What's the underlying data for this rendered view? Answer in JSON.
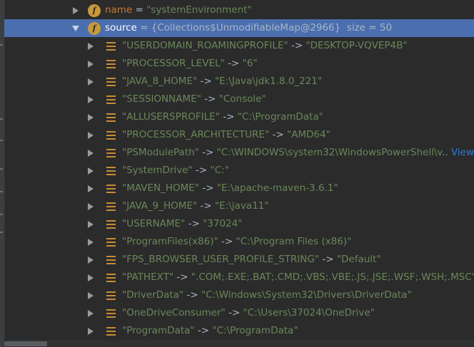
{
  "name_row": {
    "key": "name",
    "op": " = ",
    "value": "\"systemEnvironment\""
  },
  "source_row": {
    "key": "source",
    "text": " = {Collections$UnmodifiableMap@2966}  size = 50"
  },
  "entries": [
    {
      "key": "\"USERDOMAIN_ROAMINGPROFILE\"",
      "value": "\"DESKTOP-VQVEP4B\""
    },
    {
      "key": "\"PROCESSOR_LEVEL\"",
      "value": "\"6\""
    },
    {
      "key": "\"JAVA_8_HOME\"",
      "value": "\"E:\\Java\\jdk1.8.0_221\""
    },
    {
      "key": "\"SESSIONNAME\"",
      "value": "\"Console\""
    },
    {
      "key": "\"ALLUSERSPROFILE\"",
      "value": "\"C:\\ProgramData\""
    },
    {
      "key": "\"PROCESSOR_ARCHITECTURE\"",
      "value": "\"AMD64\""
    },
    {
      "key": "\"PSModulePath\"",
      "value": "\"C:\\WINDOWS\\system32\\WindowsPowerShell\\v",
      "truncated": true
    },
    {
      "key": "\"SystemDrive\"",
      "value": "\"C:\""
    },
    {
      "key": "\"MAVEN_HOME\"",
      "value": "\"E:\\apache-maven-3.6.1\""
    },
    {
      "key": "\"JAVA_9_HOME\"",
      "value": "\"E:\\java11\""
    },
    {
      "key": "\"USERNAME\"",
      "value": "\"37024\""
    },
    {
      "key": "\"ProgramFiles(x86)\"",
      "value": "\"C:\\Program Files (x86)\""
    },
    {
      "key": "\"FPS_BROWSER_USER_PROFILE_STRING\"",
      "value": "\"Default\""
    },
    {
      "key": "\"PATHEXT\"",
      "value": "\".COM;.EXE;.BAT;.CMD;.VBS;.VBE;.JS;.JSE;.WSF;.WSH;.MSC\""
    },
    {
      "key": "\"DriverData\"",
      "value": "\"C:\\Windows\\System32\\Drivers\\DriverData\""
    },
    {
      "key": "\"OneDriveConsumer\"",
      "value": "\"C:\\Users\\37024\\OneDrive\""
    },
    {
      "key": "\"ProgramData\"",
      "value": "\"C:\\ProgramData\""
    }
  ],
  "arrow_sep": " -> ",
  "ellipsis": "...",
  "view_link": "View",
  "colors": {
    "background": "#2b2b2b",
    "selection": "#4b6eaf",
    "string": "#6a8759",
    "field_name": "#cc7832",
    "field_icon": "#c79a3a",
    "link": "#287bde"
  },
  "icons": {
    "field": "field-f-icon",
    "entry": "map-entry-icon",
    "expand": "chevron-right-icon",
    "collapse": "chevron-down-icon"
  }
}
